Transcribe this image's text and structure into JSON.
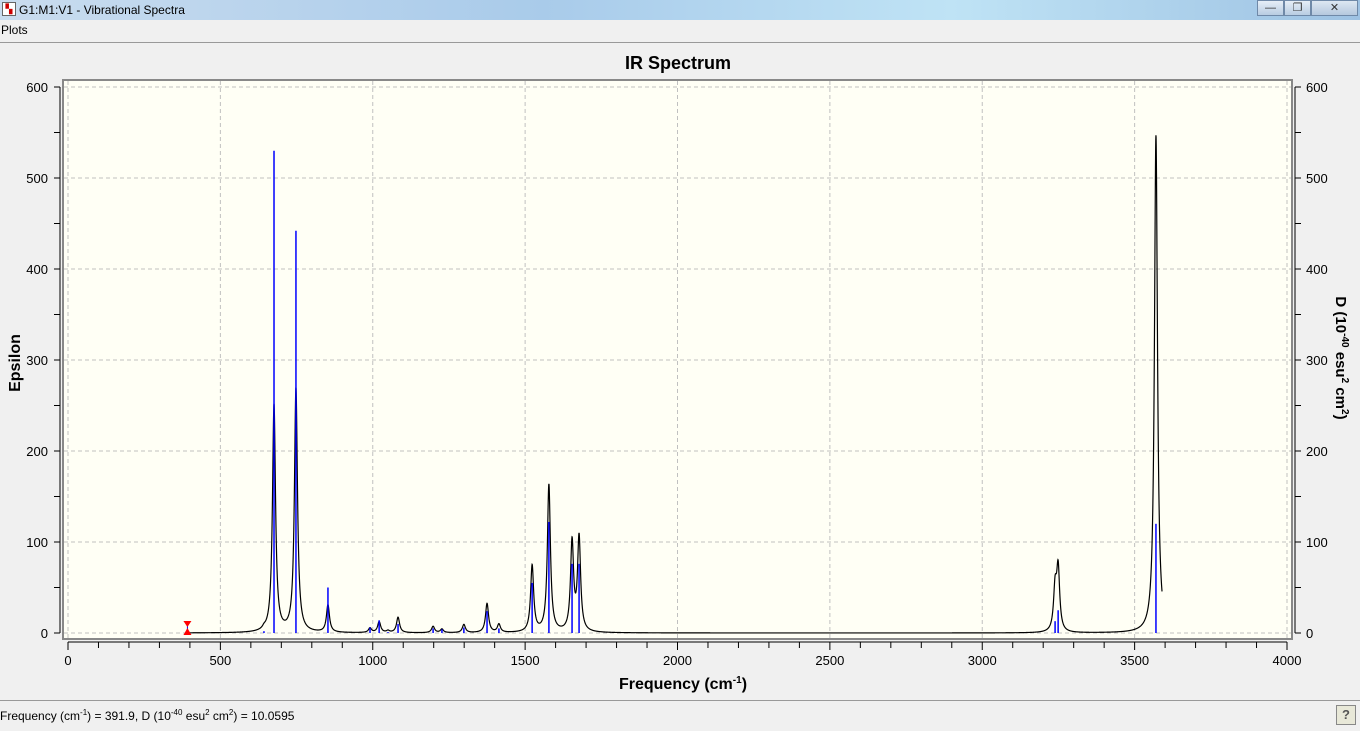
{
  "window": {
    "title": "G1:M1:V1 - Vibrational Spectra",
    "minimize": "—",
    "maximize": "❐",
    "close": "✕",
    "icon": "spectrum-app-icon"
  },
  "menu": {
    "plots": "Plots"
  },
  "status": {
    "freq_label": "Frequency (cm",
    "freq_sup": "-1",
    "freq_value": ") = 391.9, D (10",
    "d_sup": "-40",
    "d_mid": " esu",
    "d_sup2": "2",
    "d_mid2": " cm",
    "d_sup3": "2",
    "d_value": ") = 10.0595",
    "help": "?"
  },
  "chart_data": {
    "type": "line",
    "title": "IR Spectrum",
    "xlabel": "Frequency (cm",
    "xlabel_sup": "-1",
    "xlabel_end": ")",
    "ylabel_left": "Epsilon",
    "ylabel_right": "D (10",
    "ylabel_right_sup": "-40",
    "ylabel_right_mid": " esu",
    "ylabel_right_sup2": "2",
    "ylabel_right_mid2": " cm",
    "ylabel_right_sup3": "2",
    "ylabel_right_end": ")",
    "xlim": [
      0,
      4000
    ],
    "ylim": [
      0,
      600
    ],
    "xticks": [
      0,
      500,
      1000,
      1500,
      2000,
      2500,
      3000,
      3500,
      4000
    ],
    "yticks": [
      0,
      100,
      200,
      300,
      400,
      500,
      600
    ],
    "grid": true,
    "curve_range": [
      391.9,
      3590
    ],
    "hwhm": 6,
    "peaks": [
      {
        "freq": 643,
        "d": 2,
        "eps": 2
      },
      {
        "freq": 676,
        "d": 530,
        "eps": 250
      },
      {
        "freq": 748,
        "d": 442,
        "eps": 268
      },
      {
        "freq": 853,
        "d": 50,
        "eps": 30
      },
      {
        "freq": 991,
        "d": 6,
        "eps": 5
      },
      {
        "freq": 1021,
        "d": 14,
        "eps": 12
      },
      {
        "freq": 1050,
        "d": 1,
        "eps": 2
      },
      {
        "freq": 1083,
        "d": 10,
        "eps": 17
      },
      {
        "freq": 1198,
        "d": 5,
        "eps": 7
      },
      {
        "freq": 1227,
        "d": 4,
        "eps": 4
      },
      {
        "freq": 1299,
        "d": 6,
        "eps": 9
      },
      {
        "freq": 1375,
        "d": 24,
        "eps": 32
      },
      {
        "freq": 1414,
        "d": 5,
        "eps": 9
      },
      {
        "freq": 1523,
        "d": 55,
        "eps": 73
      },
      {
        "freq": 1578,
        "d": 122,
        "eps": 162
      },
      {
        "freq": 1654,
        "d": 76,
        "eps": 98
      },
      {
        "freq": 1677,
        "d": 76,
        "eps": 103
      },
      {
        "freq": 3239,
        "d": 13,
        "eps": 45
      },
      {
        "freq": 3249,
        "d": 25,
        "eps": 68
      },
      {
        "freq": 3570,
        "d": 120,
        "eps": 547
      }
    ],
    "cursor": {
      "freq": 391.9,
      "d": 10.0595
    },
    "colors": {
      "curve": "#000000",
      "sticks": "#0000ff",
      "cursor": "#ff0000",
      "plot_bg": "#fffff5"
    }
  }
}
